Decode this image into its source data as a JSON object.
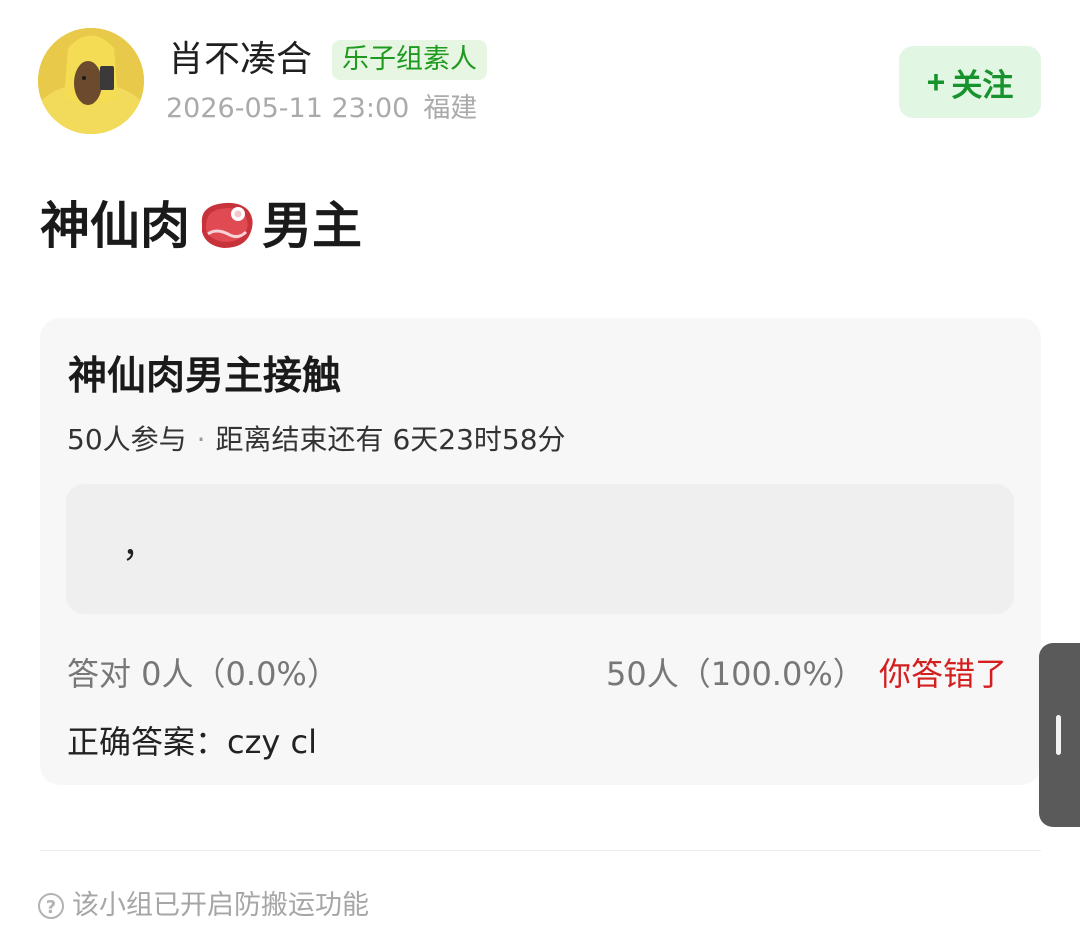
{
  "user": {
    "name": "肖不凑合",
    "group_badge": "乐子组素人",
    "timestamp": "2026-05-11 23:00",
    "location": "福建"
  },
  "follow": {
    "plus": "+",
    "label": "关注"
  },
  "post": {
    "title_before": "神仙肉",
    "title_after": "男主",
    "title_icon": "meat-icon"
  },
  "quiz": {
    "title": "神仙肉男主接触",
    "participants": "50人参与",
    "separator": "·",
    "time_left": "距离结束还有 6天23时58分",
    "answer_text": "，",
    "correct_stat": "答对  0人（0.0%）",
    "wrong_stat": "50人（100.0%）",
    "wrong_flag": "你答错了",
    "correct_answer": "正确答案：czy cl"
  },
  "footer": {
    "icon": "help-icon",
    "icon_glyph": "?",
    "note": "该小组已开启防搬运功能"
  },
  "colors": {
    "accent_green": "#17922c",
    "badge_bg": "#e6f6e3",
    "error_red": "#d41f1f"
  }
}
